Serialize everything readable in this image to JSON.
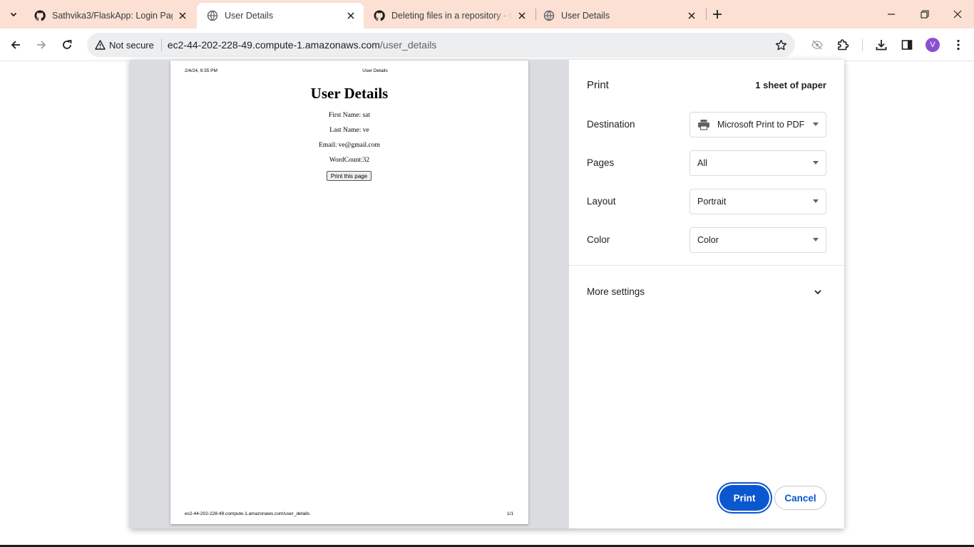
{
  "tabs": [
    {
      "title": "Sathvika3/FlaskApp: Login Page",
      "favicon": "github-icon"
    },
    {
      "title": "User Details",
      "favicon": "globe-icon",
      "active": true
    },
    {
      "title": "Deleting files in a repository - G",
      "favicon": "github-icon"
    },
    {
      "title": "User Details",
      "favicon": "globe-icon"
    }
  ],
  "omnibox": {
    "security_chip": "Not secure",
    "url_host": "ec2-44-202-228-49.compute-1.amazonaws.com",
    "url_path": "/user_details"
  },
  "profile": {
    "initial": "V",
    "color": "#8a4fd1"
  },
  "preview": {
    "header_date": "2/4/24, 9:35 PM",
    "header_title": "User Details",
    "heading": "User Details",
    "first_name": "First Name: sat",
    "last_name": "Last Name: ve",
    "email": "Email: ve@gmail.com",
    "word_count": "WordCount:32",
    "print_button": "Print this page",
    "footer_url": "ec2-44-202-228-49.compute-1.amazonaws.com/user_details",
    "footer_page": "1/1"
  },
  "print_settings": {
    "title": "Print",
    "sheets": "1 sheet of paper",
    "destination_label": "Destination",
    "destination_value": "Microsoft Print to PDF",
    "pages_label": "Pages",
    "pages_value": "All",
    "layout_label": "Layout",
    "layout_value": "Portrait",
    "color_label": "Color",
    "color_value": "Color",
    "more_settings": "More settings",
    "print_button": "Print",
    "cancel_button": "Cancel"
  },
  "colors": {
    "tabstrip": "#fbe0d3",
    "accent": "#0b57d0",
    "preview_bg": "#dadce0"
  }
}
